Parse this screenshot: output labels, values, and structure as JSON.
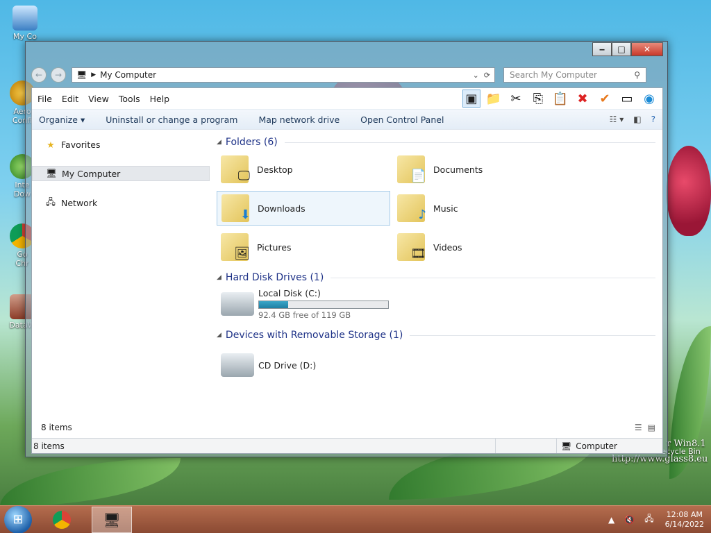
{
  "desktop": {
    "icons": [
      {
        "label": "My Co"
      },
      {
        "label": "Aero"
      },
      {
        "label": "Confi"
      },
      {
        "label": "Inte"
      },
      {
        "label": "Dow"
      },
      {
        "label": "Go"
      },
      {
        "label": "Chr"
      },
      {
        "label": "DataW"
      }
    ],
    "recycle_bin": "Recycle Bin",
    "watermark_line1": "r Win8.1",
    "watermark_line2": "http://www.glass8.eu"
  },
  "window": {
    "address": {
      "crumb": "My Computer"
    },
    "search": {
      "placeholder": "Search My Computer"
    },
    "menu": [
      "File",
      "Edit",
      "View",
      "Tools",
      "Help"
    ],
    "commands": [
      "Organize ▾",
      "Uninstall or change a program",
      "Map network drive",
      "Open Control Panel"
    ],
    "nav": {
      "favorites": "Favorites",
      "my_computer": "My Computer",
      "network": "Network"
    },
    "groups": {
      "folders": "Folders (6)",
      "hard_disk": "Hard Disk Drives (1)",
      "removable": "Devices with Removable Storage (1)"
    },
    "folders": [
      {
        "name": "Desktop",
        "icon": "monitor-icon"
      },
      {
        "name": "Documents",
        "icon": "document-icon"
      },
      {
        "name": "Downloads",
        "icon": "download-arrow-icon"
      },
      {
        "name": "Music",
        "icon": "music-note-icon"
      },
      {
        "name": "Pictures",
        "icon": "picture-icon"
      },
      {
        "name": "Videos",
        "icon": "film-icon"
      }
    ],
    "drive_c": {
      "name": "Local Disk (C:)",
      "free_text": "92.4 GB free of 119 GB",
      "used_fraction": 0.224
    },
    "cd_drive": {
      "name": "CD Drive (D:)"
    },
    "details_count": "8 items",
    "status": {
      "count": "8 items",
      "location": "Computer"
    }
  },
  "taskbar": {
    "time": "12:08 AM",
    "date": "6/14/2022"
  },
  "colors": {
    "accent": "#1e3287",
    "selection": "#eef6fc",
    "drive_bar": "#1f7fa3"
  }
}
